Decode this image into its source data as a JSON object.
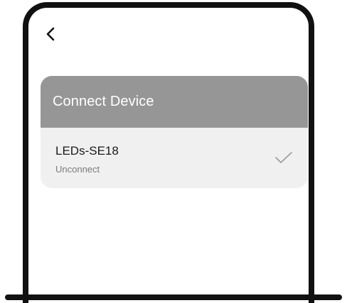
{
  "header": {
    "back_icon": "chevron-left-icon"
  },
  "card": {
    "title": "Connect Device",
    "devices": [
      {
        "name": "LEDs-SE18",
        "status": "Unconnect",
        "icon": "checkmark-icon"
      }
    ]
  },
  "colors": {
    "card_header": "#969696",
    "card_body": "#f0f0f0",
    "frame": "#111111",
    "check": "#9a9a9a"
  }
}
